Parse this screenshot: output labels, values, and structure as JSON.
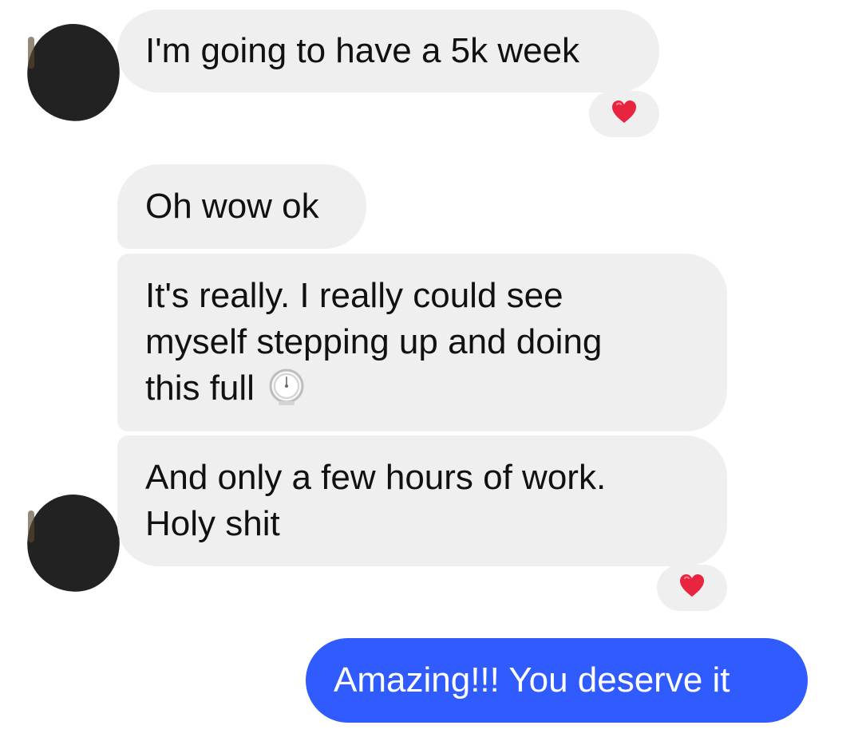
{
  "conversation": {
    "messages": [
      {
        "direction": "incoming",
        "lines": [
          "I'm going to have a 5k week"
        ],
        "reaction": "heart"
      },
      {
        "direction": "incoming",
        "lines": [
          "Oh wow ok"
        ]
      },
      {
        "direction": "incoming",
        "lines": [
          "It's really. I really could see",
          "myself stepping up and doing",
          "this full"
        ],
        "emoji": "timer-clock"
      },
      {
        "direction": "incoming",
        "lines": [
          "And only a few hours of work.",
          "Holy shit"
        ],
        "reaction": "heart"
      },
      {
        "direction": "outgoing",
        "lines": [
          "Amazing!!! You deserve it"
        ]
      }
    ]
  },
  "colors": {
    "incoming_bubble": "#efefef",
    "outgoing_bubble": "#2f5bff",
    "incoming_text": "#111111",
    "outgoing_text": "#ffffff",
    "reaction_heart": "#e8243f",
    "avatar_redacted": "#222222"
  }
}
